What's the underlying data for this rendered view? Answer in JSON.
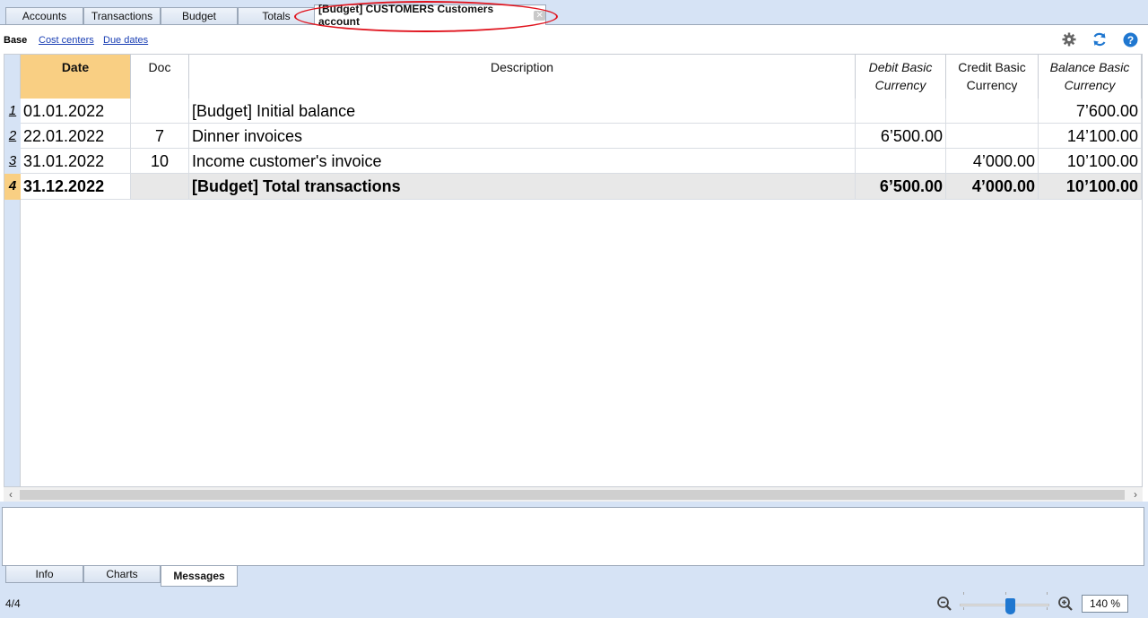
{
  "top_tabs": [
    {
      "label": "Accounts"
    },
    {
      "label": "Transactions"
    },
    {
      "label": "Budget"
    },
    {
      "label": "Totals"
    },
    {
      "label": "[Budget] CUSTOMERS Customers account",
      "active": true
    }
  ],
  "subtabs": {
    "base": "Base",
    "cost_centers": "Cost centers",
    "due_dates": "Due dates"
  },
  "toolbar_icons": [
    "gear-icon",
    "refresh-icon",
    "help-icon"
  ],
  "columns": {
    "date": "Date",
    "doc": "Doc",
    "description": "Description",
    "debit_1": "Debit Basic",
    "debit_2": "Currency",
    "credit_1": "Credit Basic",
    "credit_2": "Currency",
    "balance_1": "Balance Basic",
    "balance_2": "Currency"
  },
  "rows": [
    {
      "num": "1",
      "date": "01.01.2022",
      "doc": "",
      "description": "[Budget] Initial balance",
      "debit": "",
      "credit": "",
      "balance": "7’600.00"
    },
    {
      "num": "2",
      "date": "22.01.2022",
      "doc": "7",
      "description": "Dinner invoices",
      "debit": "6’500.00",
      "credit": "",
      "balance": "14’100.00"
    },
    {
      "num": "3",
      "date": "31.01.2022",
      "doc": "10",
      "description": "Income customer's invoice",
      "debit": "",
      "credit": "4’000.00",
      "balance": "10’100.00"
    },
    {
      "num": "4",
      "date": "31.12.2022",
      "doc": "",
      "description": "[Budget] Total transactions",
      "debit": "6’500.00",
      "credit": "4’000.00",
      "balance": "10’100.00",
      "total": true
    }
  ],
  "bottom_tabs": [
    {
      "label": "Info"
    },
    {
      "label": "Charts"
    },
    {
      "label": "Messages",
      "active": true
    }
  ],
  "status": {
    "row_position": "4/4",
    "zoom": "140 %"
  },
  "colors": {
    "header_date": "#f9cf83",
    "background": "#d6e3f5",
    "accent_blue": "#1f77d0",
    "highlight_red": "#e0141e"
  }
}
